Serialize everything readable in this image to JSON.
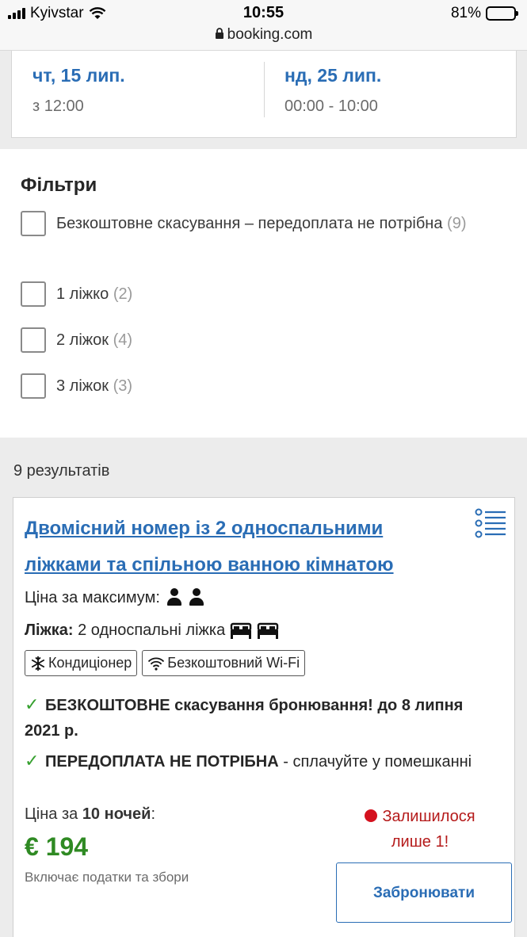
{
  "status_bar": {
    "carrier": "Kyivstar",
    "time": "10:55",
    "url": "booking.com",
    "battery": "81%",
    "battery_level": 0.81
  },
  "dates": {
    "checkin_date": "чт, 15 лип.",
    "checkin_time": "з 12:00",
    "checkout_date": "нд, 25 лип.",
    "checkout_time": "00:00 - 10:00"
  },
  "filters": {
    "title": "Фільтри",
    "items": [
      {
        "label": "Безкоштовне скасування – передоплата не потрібна",
        "count": "(9)"
      },
      {
        "label": "1 ліжко",
        "count": "(2)"
      },
      {
        "label": "2 ліжок",
        "count": "(4)"
      },
      {
        "label": "3 ліжок",
        "count": "(3)"
      }
    ]
  },
  "results": {
    "count_text": "9 результатів"
  },
  "room": {
    "title": "Двомісний номер із 2 односпальними ліжками та спільною ванною кімнатою",
    "max_label": "Ціна за максимум:",
    "max_guests": 2,
    "beds_label": "Ліжка:",
    "beds_value": "2 односпальні ліжка",
    "amenities": [
      {
        "icon": "snowflake-icon",
        "label": "Кондиціонер"
      },
      {
        "icon": "wifi-icon",
        "label": "Безкоштовний Wi-Fi"
      }
    ],
    "cancel_bold": "БЕЗКОШТОВНЕ скасування бронювання! до 8 липня 2021 р.",
    "prepay_bold": "ПЕРЕДОПЛАТА НЕ ПОТРІБНА",
    "prepay_rest": " - сплачуйте у помешканні",
    "price_prefix": "Ціна за ",
    "price_nights": "10 ночей",
    "price_suffix": ":",
    "price": "€ 194",
    "taxes": "Включає податки та збори",
    "urgency_1": "Залишилося",
    "urgency_2": "лише 1!",
    "book_label": "Забронювати"
  },
  "colors": {
    "link_blue": "#2a6db5",
    "price_green": "#2f8a23",
    "check_green": "#35a02e",
    "urgency_red": "#b51a1a"
  }
}
